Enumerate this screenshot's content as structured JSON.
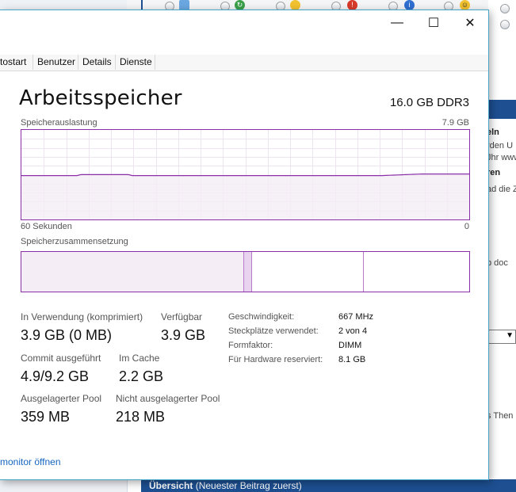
{
  "background_app": {
    "snippets": [
      "eln",
      "rden U",
      "Jhr www.",
      "ren",
      "ad die Z",
      "p doc",
      "s Then"
    ],
    "footer_bold": "Übersicht",
    "footer_rest": " (Neuester Beitrag zuerst)"
  },
  "window": {
    "minimize_glyph": "—",
    "maximize_glyph": "☐",
    "close_glyph": "✕"
  },
  "tabs": [
    {
      "label": "tostart"
    },
    {
      "label": "Benutzer"
    },
    {
      "label": "Details"
    },
    {
      "label": "Dienste"
    }
  ],
  "memory": {
    "title": "Arbeitsspeicher",
    "total": "16.0 GB DDR3",
    "usage_label": "Speicherauslastung",
    "usage_max": "7.9 GB",
    "time_left": "60 Sekunden",
    "time_right": "0",
    "usage_level_fraction": 0.49,
    "composition_label": "Speicherzusammensetzung",
    "composition_fractions": {
      "in_use": 0.495,
      "modified": 0.02,
      "standby": 0.25,
      "free": 0.235
    }
  },
  "stats": {
    "in_use_label": "In Verwendung (komprimiert)",
    "in_use_value": "3.9 GB (0 MB)",
    "available_label": "Verfügbar",
    "available_value": "3.9 GB",
    "commit_label": "Commit ausgeführt",
    "commit_value": "4.9/9.2 GB",
    "cached_label": "Im Cache",
    "cached_value": "2.2 GB",
    "paged_label": "Ausgelagerter Pool",
    "paged_value": "359 MB",
    "nonpaged_label": "Nicht ausgelagerter Pool",
    "nonpaged_value": "218 MB"
  },
  "details": [
    {
      "key": "Geschwindigkeit:",
      "value": "667 MHz"
    },
    {
      "key": "Steckplätze verwendet:",
      "value": "2 von 4"
    },
    {
      "key": "Formfaktor:",
      "value": "DIMM"
    },
    {
      "key": "Für Hardware reserviert:",
      "value": "8.1 GB"
    }
  ],
  "footer_link": "monitor öffnen",
  "colors": {
    "accent_purple": "#8b2fa8",
    "fill_purple": "#f4edf6",
    "link_blue": "#1565c0",
    "window_border": "#4aa4c8"
  }
}
